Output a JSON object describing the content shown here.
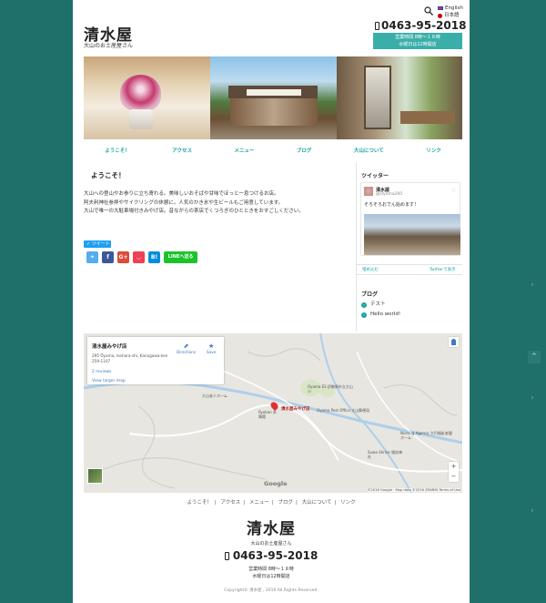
{
  "header": {
    "brand": "清水屋",
    "tagline": "大山のお土産屋さん",
    "phone": "0463-95-2018",
    "hours_line1": "営業時間 8時〜１８時",
    "hours_line2": "水曜日は12時開店",
    "languages": [
      "English",
      "日本語"
    ]
  },
  "nav": [
    "ようこそ！",
    "アクセス",
    "メニュー",
    "ブログ",
    "大山について",
    "リンク"
  ],
  "main": {
    "title": "ようこそ！",
    "lines": [
      "大山への登山やお参りに立ち寄れる。美味しいおそばや甘味でほっと一息つけるお店。",
      "阿夫利神社参拝やサイクリングの休憩に。人気のかき氷や生ビールもご用意しています。",
      "大山で唯一の大駐車場付きみやげ店。昔ながらの茶店でくつろぎのひとときをおすごしください。"
    ],
    "tweet_button": "ツイート",
    "share": {
      "twitter": "",
      "facebook": "f",
      "google": "G+",
      "pocket": "",
      "hatena": "B!",
      "line": "LINEへ送る"
    }
  },
  "sidebar": {
    "twitter_heading": "ツイッター",
    "tw_name": "清水屋",
    "tw_handle": "@Oyama295",
    "tw_text": "そろそろおでん始めます！",
    "tw_embed": "埋め込む",
    "tw_view": "Twitterで表示",
    "blog_heading": "ブログ",
    "posts": [
      "テスト",
      "Hello world!"
    ]
  },
  "map": {
    "title": "清水屋みやげ店",
    "address": "295 Öyama, Isehara-shi, Kanagawa-ken 259-1107",
    "directions": "Directions",
    "save": "Save",
    "reviews": "2 reviews",
    "larger": "View larger map",
    "pin_label": "清水屋みやげ店",
    "google": "Google",
    "footer": "©2016 Google · Map data ©2016 ZENRIN   Terms of Use",
    "labels": {
      "elder": "大山老人ホーム",
      "ryokan": "Ryokan 本陣館",
      "es": "Oyama ES 伊勢原市立大山小",
      "post": "Oyama Post Office 大山郵便局",
      "nursing": "Nursing Agency 大円福祉老健ホーム",
      "suwa": "Suwa Shrine 諏訪神社"
    }
  },
  "footer": {
    "nav": [
      "ようこそ！",
      "アクセス",
      "メニュー",
      "ブログ",
      "大山について",
      "リンク"
    ],
    "brand": "清水屋",
    "tagline": "大山のお土産屋さん",
    "phone": "0463-95-2018",
    "hours_line1": "営業時間 8時〜１８時",
    "hours_line2": "水曜日は12時開店",
    "copyright": "Copyright© 清水屋 , 2016 All Rights Reserved."
  },
  "colors": {
    "background": "#1f6f6b",
    "accent": "#3aafaa",
    "nav": "#1aa39d"
  }
}
